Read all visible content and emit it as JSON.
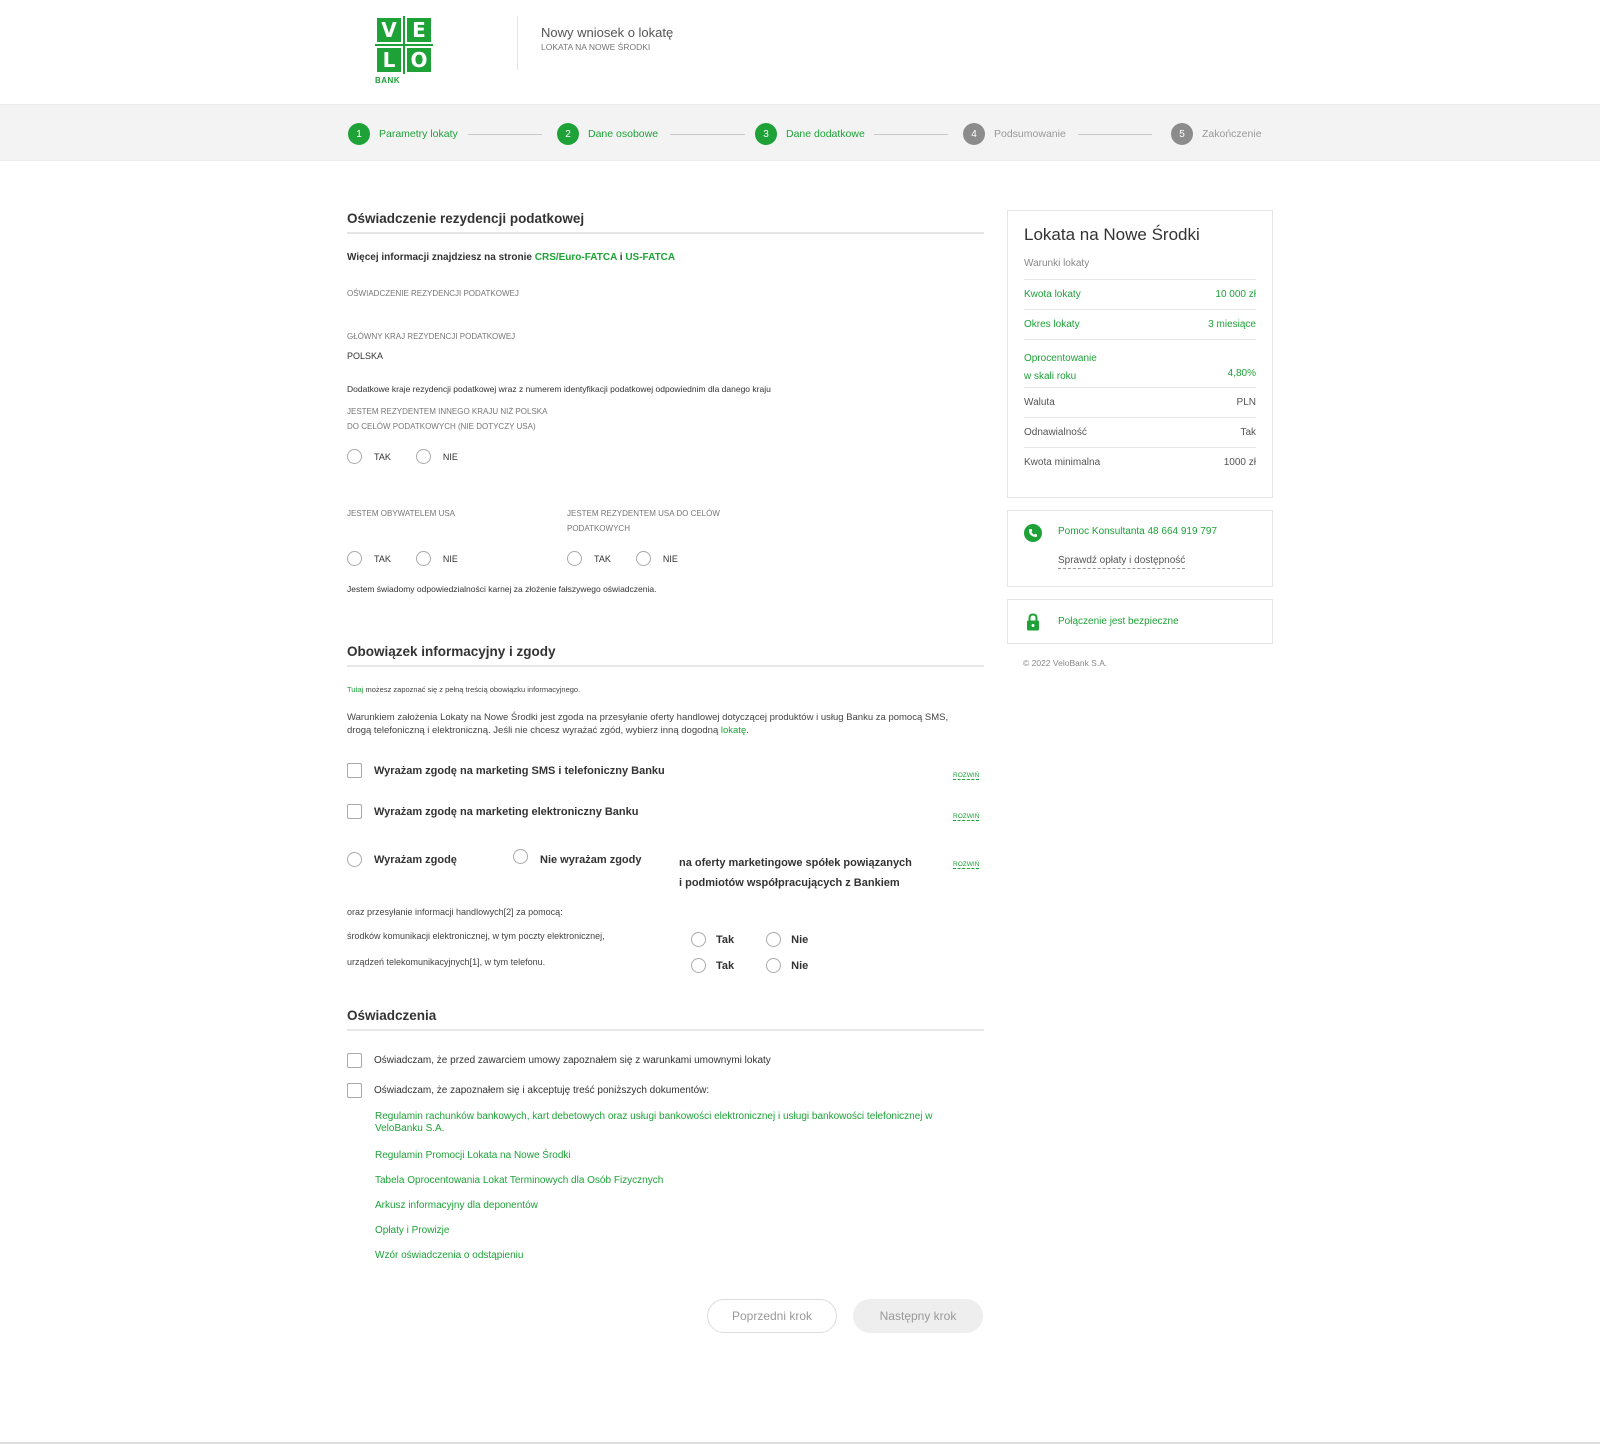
{
  "header": {
    "logo_letters": [
      "V",
      "E",
      "L",
      "O"
    ],
    "logo_bank": "BANK",
    "title": "Nowy wniosek o lokatę",
    "subtitle": "LOKATA NA NOWE ŚRODKI"
  },
  "stepper": [
    {
      "num": "1",
      "label": "Parametry lokaty",
      "active": true
    },
    {
      "num": "2",
      "label": "Dane osobowe",
      "active": true
    },
    {
      "num": "3",
      "label": "Dane dodatkowe",
      "active": true
    },
    {
      "num": "4",
      "label": "Podsumowanie",
      "active": false
    },
    {
      "num": "5",
      "label": "Zakończenie",
      "active": false
    }
  ],
  "tax": {
    "title": "Oświadczenie rezydencji podatkowej",
    "info_prefix": "Więcej informacji znajdziesz na stronie ",
    "link_crs": "CRS/Euro-FATCA",
    "info_and": " i ",
    "link_us": "US-FATCA",
    "section_label": "OŚWIADCZENIE REZYDENCJI PODATKOWEJ",
    "main_country_label": "GŁÓWNY KRAJ REZYDENCJI PODATKOWEJ",
    "main_country_value": "POLSKA",
    "additional_text": "Dodatkowe kraje rezydencji podatkowej wraz z numerem identyfikacji podatkowej odpowiednim dla danego kraju",
    "other_country_q1": "JESTEM REZYDENTEM INNEGO KRAJU NIŻ POLSKA",
    "other_country_q2": "DO CELÓW PODATKOWYCH (NIE DOTYCZY USA)",
    "usa_citizen_q": "JESTEM OBYWATELEM USA",
    "usa_resident_q1": "JESTEM REZYDENTEM USA DO CELÓW",
    "usa_resident_q2": "PODATKOWYCH",
    "yes": "TAK",
    "no": "NIE",
    "liability": "Jestem świadomy odpowiedzialności karnej za złożenie fałszywego oświadczenia."
  },
  "consents": {
    "title": "Obowiązek informacyjny i zgody",
    "info_link": "Tutaj",
    "info_rest": " możesz zapoznać się z pełną treścią obowiązku informacyjnego.",
    "condition_line1": "Warunkiem założenia Lokaty na Nowe Środki jest zgoda na przesyłanie oferty handlowej dotyczącej produktów i usług Banku za pomocą SMS,",
    "condition_line2_prefix": "drogą telefoniczną i elektroniczną. Jeśli nie chcesz wyrażać zgód, wybierz inną dogodną ",
    "condition_link": "lokatę",
    "condition_end": ".",
    "sms_consent": "Wyrażam zgodę na marketing SMS i telefoniczny Banku",
    "email_consent": "Wyrażam zgodę na marketing elektroniczny Banku",
    "expand": "ROZWIŃ",
    "agree": "Wyrażam zgodę",
    "disagree": "Nie wyrażam zgody",
    "partners_line1": "na oferty marketingowe spółek powiązanych",
    "partners_line2": "i podmiotów współpracujących z Bankiem",
    "channels_intro": "oraz przesyłanie informacji handlowych[2] za pomocą:",
    "channel_email": "środków komunikacji elektronicznej, w tym poczty elektronicznej,",
    "channel_phone": "urządzeń telekomunikacyjnych[1], w tym telefonu.",
    "tak": "Tak",
    "nie": "Nie"
  },
  "declarations": {
    "title": "Oświadczenia",
    "decl1": "Oświadczam, że przed zawarciem umowy zapoznałem się z warunkami umownymi lokaty",
    "decl2": "Oświadczam, że zapoznałem się i akceptuję treść poniższych dokumentów:",
    "docs": [
      "Regulamin rachunków bankowych, kart debetowych oraz usługi bankowości elektronicznej i usługi bankowości telefonicznej w VeloBanku S.A.",
      "Regulamin Promocji Lokata na Nowe Środki",
      "Tabela Oprocentowania Lokat Terminowych dla Osób Fizycznych",
      "Arkusz informacyjny dla deponentów",
      "Opłaty i Prowizje",
      "Wzór oświadczenia o odstąpieniu"
    ]
  },
  "buttons": {
    "prev": "Poprzedni krok",
    "next": "Następny krok"
  },
  "summary": {
    "title": "Lokata na Nowe Środki",
    "subtitle": "Warunki lokaty",
    "rows": [
      {
        "label": "Kwota lokaty",
        "value": "10 000 zł"
      },
      {
        "label": "Okres lokaty",
        "value": "3 miesiące"
      },
      {
        "label": "Oprocentowanie",
        "label2": "w skali roku",
        "value": "4,80%"
      },
      {
        "label": "Waluta",
        "value": "PLN"
      },
      {
        "label": "Odnawialność",
        "value": "Tak"
      },
      {
        "label": "Kwota minimalna",
        "value": "1000 zł"
      }
    ]
  },
  "help": {
    "phone": "Pomoc Konsultanta 48 664 919 797",
    "fees_link": "Sprawdź opłaty i dostępność"
  },
  "secure": {
    "text": "Połączenie jest bezpieczne"
  },
  "footer": {
    "copyright": "© 2022 VeloBank S.A."
  },
  "colors": {
    "brand_green": "#1ea238",
    "inactive_step": "#8c8c8c"
  }
}
